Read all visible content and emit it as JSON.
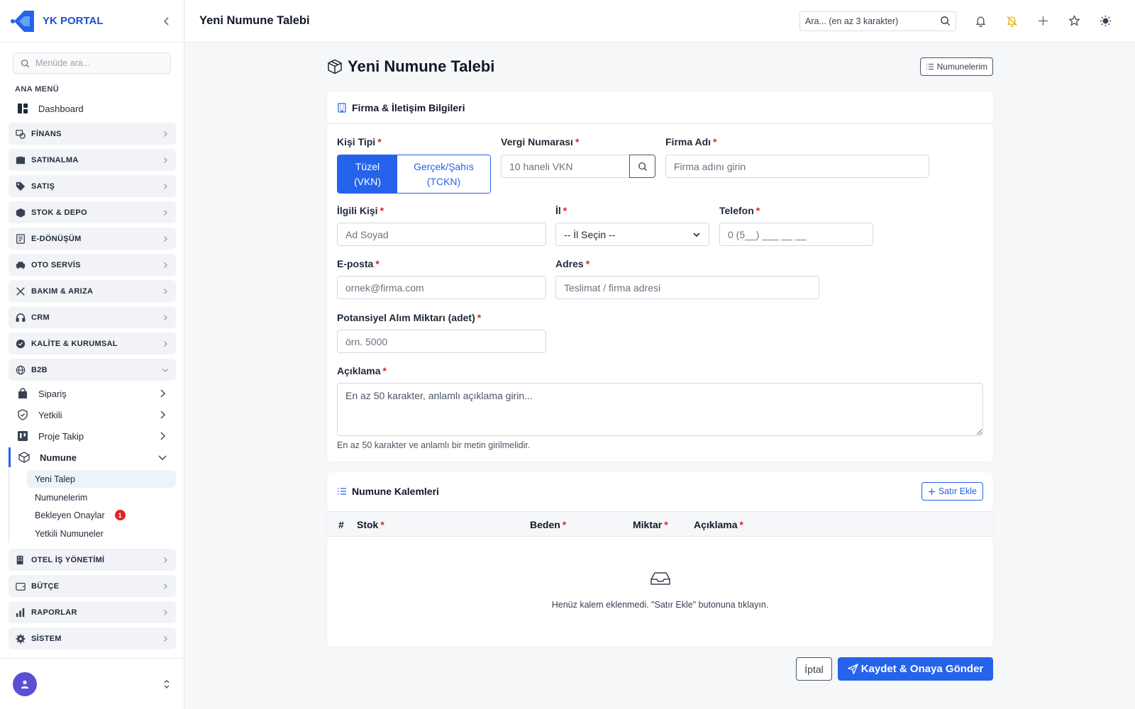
{
  "brand": {
    "name": "YK PORTAL",
    "accent": "#2563eb"
  },
  "sidebar": {
    "search_placeholder": "Menüde ara...",
    "section_title": "ANA MENÜ",
    "dashboard": "Dashboard",
    "groups": {
      "finans": "FİNANS",
      "satinalma": "SATINALMA",
      "satis": "SATIŞ",
      "stok": "STOK & DEPO",
      "edonusum": "E-DÖNÜŞÜM",
      "oto": "OTO SERVİS",
      "bakim": "BAKIM & ARIZA",
      "crm": "CRM",
      "kalite": "KALİTE & KURUMSAL",
      "b2b": "B2B",
      "otel": "OTEL İŞ YÖNETİMİ",
      "butce": "BÜTÇE",
      "raporlar": "RAPORLAR",
      "sistem": "SİSTEM"
    },
    "b2b_items": {
      "siparis": "Sipariş",
      "yetkili": "Yetkili",
      "proje": "Proje Takip",
      "numune": "Numune"
    },
    "numune_items": {
      "yeni": "Yeni Talep",
      "numunelerim": "Numunelerim",
      "bekleyen": "Bekleyen Onaylar",
      "bekleyen_count": "1",
      "yetkili_numuneler": "Yetkili Numuneler"
    }
  },
  "topbar": {
    "title": "Yeni Numune Talebi",
    "search_placeholder": "Ara... (en az 3 karakter)"
  },
  "page": {
    "title": "Yeni Numune Talebi",
    "my_samples_button": "Numunelerim"
  },
  "company_card": {
    "title": "Firma & İletişim Bilgileri",
    "person_type_label": "Kişi Tipi",
    "person_type_options": {
      "legal_1": "Tüzel",
      "legal_2": "(VKN)",
      "real_1": "Gerçek/Şahıs",
      "real_2": "(TCKN)"
    },
    "tax_label": "Vergi Numarası",
    "tax_placeholder": "10 haneli VKN",
    "company_label": "Firma Adı",
    "company_placeholder": "Firma adını girin",
    "contact_label": "İlgili Kişi",
    "contact_placeholder": "Ad Soyad",
    "city_label": "İl",
    "city_value": "-- İl Seçin --",
    "phone_label": "Telefon",
    "phone_placeholder": "0 (5__) ___ __ __",
    "email_label": "E-posta",
    "email_placeholder": "ornek@firma.com",
    "address_label": "Adres",
    "address_placeholder": "Teslimat / firma adresi",
    "quantity_label": "Potansiyel Alım Miktarı (adet)",
    "quantity_placeholder": "örn. 5000",
    "desc_label": "Açıklama",
    "desc_placeholder": "En az 50 karakter, anlamlı açıklama girin...",
    "desc_hint": "En az 50 karakter ve anlamlı bir metin girilmelidir.",
    "required_mark": "*"
  },
  "items_card": {
    "title": "Numune Kalemleri",
    "add_row_button": "Satır Ekle",
    "columns": {
      "no": "#",
      "stock": "Stok",
      "size": "Beden",
      "qty": "Miktar",
      "desc": "Açıklama"
    },
    "empty_text": "Henüz kalem eklenmedi. \"Satır Ekle\" butonuna tıklayın."
  },
  "actions": {
    "cancel": "İptal",
    "submit": "Kaydet & Onaya Gönder"
  }
}
